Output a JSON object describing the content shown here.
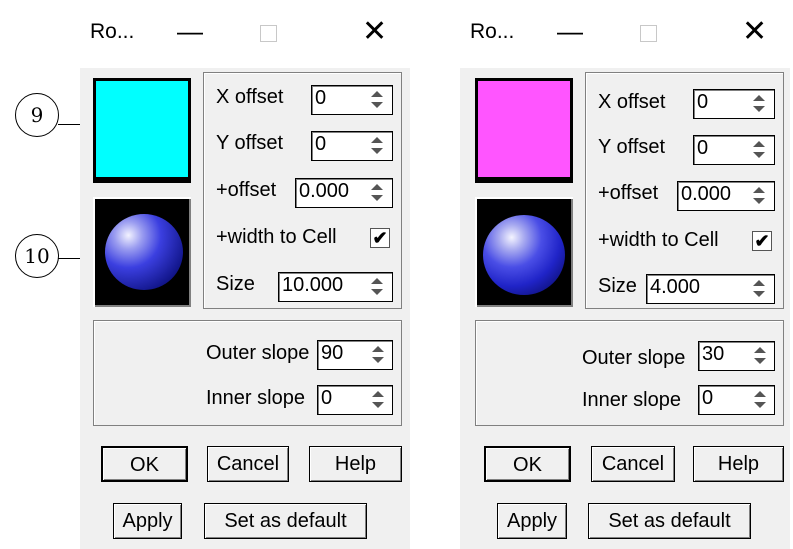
{
  "callouts": [
    "9",
    "10"
  ],
  "dialogs": [
    {
      "title": "Ro...",
      "minimize_glyph": "—",
      "close_glyph": "✕",
      "swatch_color": "#00ffff",
      "x_offset_label": "X offset",
      "x_offset": "0",
      "y_offset_label": "Y offset",
      "y_offset": "0",
      "plus_offset_label": "+offset",
      "plus_offset": "0.000",
      "width_to_cell_label": "+width to Cell",
      "width_to_cell_checked": true,
      "check_glyph": "✔",
      "size_label": "Size",
      "size": "10.000",
      "outer_slope_label": "Outer slope",
      "outer_slope": "90",
      "inner_slope_label": "Inner slope",
      "inner_slope": "0",
      "ok_label": "OK",
      "cancel_label": "Cancel",
      "help_label": "Help",
      "apply_label": "Apply",
      "set_default_label": "Set as default"
    },
    {
      "title": "Ro...",
      "minimize_glyph": "—",
      "close_glyph": "✕",
      "swatch_color": "#ff55ff",
      "x_offset_label": "X offset",
      "x_offset": "0",
      "y_offset_label": "Y offset",
      "y_offset": "0",
      "plus_offset_label": "+offset",
      "plus_offset": "0.000",
      "width_to_cell_label": "+width to Cell",
      "width_to_cell_checked": true,
      "check_glyph": "✔",
      "size_label": "Size",
      "size": "4.000",
      "outer_slope_label": "Outer slope",
      "outer_slope": "30",
      "inner_slope_label": "Inner slope",
      "inner_slope": "0",
      "ok_label": "OK",
      "cancel_label": "Cancel",
      "help_label": "Help",
      "apply_label": "Apply",
      "set_default_label": "Set as default"
    }
  ]
}
